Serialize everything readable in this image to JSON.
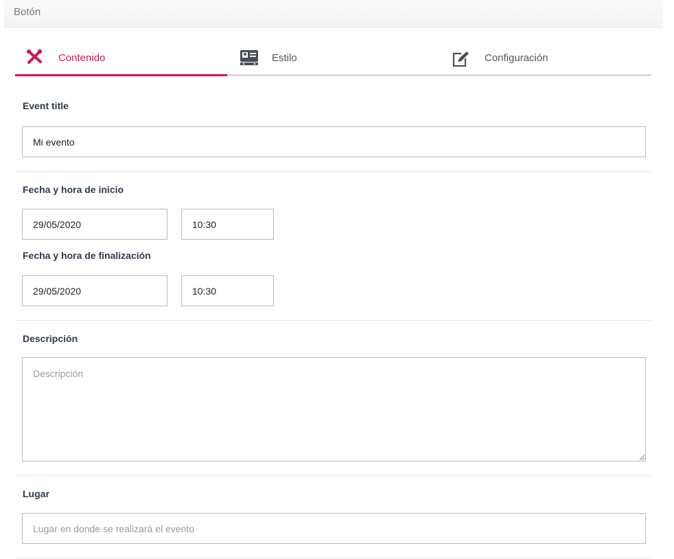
{
  "header": {
    "title": "Botón"
  },
  "tabs": [
    {
      "label": "Contenido",
      "icon": "tools-icon",
      "active": true
    },
    {
      "label": "Estilo",
      "icon": "id-card-icon",
      "active": false
    },
    {
      "label": "Configuración",
      "icon": "edit-icon",
      "active": false
    }
  ],
  "colors": {
    "accent": "#d0145e",
    "tab_line": "#d8d8d8",
    "label": "#2f3a4b"
  },
  "event_title": {
    "label": "Event title",
    "value": "Mi evento"
  },
  "start": {
    "label": "Fecha y hora de inicio",
    "date": "29/05/2020",
    "time": "10:30"
  },
  "end": {
    "label": "Fecha y hora de finalización",
    "date": "29/05/2020",
    "time": "10:30"
  },
  "description": {
    "label": "Descripción",
    "placeholder": "Descripción",
    "value": ""
  },
  "place": {
    "label": "Lugar",
    "placeholder": "Lugar en donde se realizará el evento",
    "value": ""
  }
}
